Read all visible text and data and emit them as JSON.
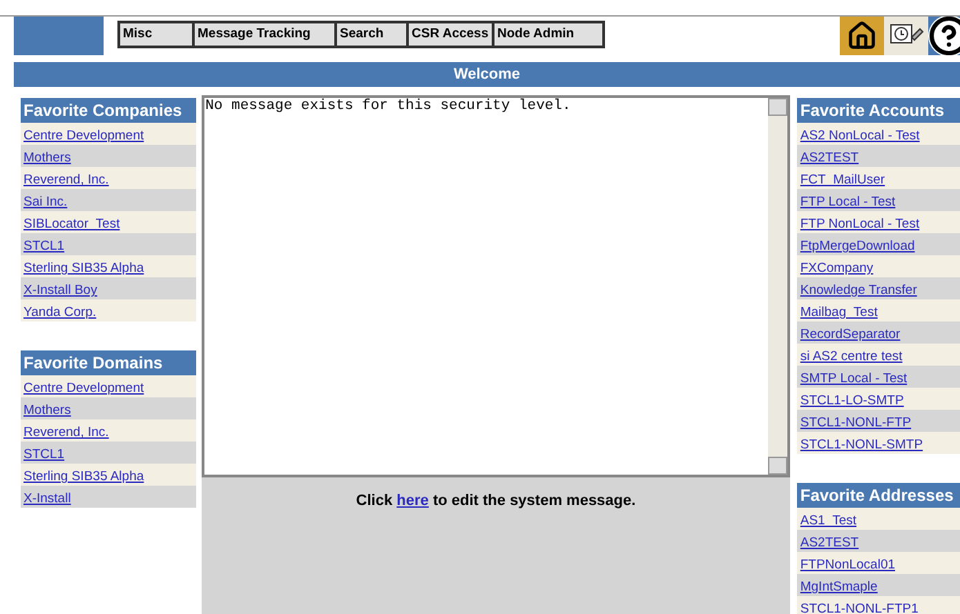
{
  "menu": [
    {
      "label": "Misc"
    },
    {
      "label": "Message Tracking"
    },
    {
      "label": "Search"
    },
    {
      "label": "CSR Access"
    },
    {
      "label": "Node Admin"
    }
  ],
  "banner": {
    "title": "Welcome"
  },
  "left": [
    {
      "title": "Favorite Companies",
      "items": [
        "Centre Development",
        "Mothers",
        "Reverend, Inc.",
        "Sai Inc.",
        "SIBLocator_Test",
        "STCL1",
        "Sterling SIB35 Alpha",
        "X-Install Boy",
        "Yanda Corp."
      ]
    },
    {
      "title": "Favorite Domains",
      "items": [
        "Centre Development",
        "Mothers",
        "Reverend, Inc.",
        "STCL1",
        "Sterling SIB35 Alpha",
        "X-Install"
      ]
    }
  ],
  "message": {
    "text": "No message exists for this security level.",
    "edit_prefix": "Click ",
    "edit_link": "here",
    "edit_suffix": " to edit the system message."
  },
  "right": [
    {
      "title": "Favorite Accounts",
      "items": [
        "AS2 NonLocal - Test",
        "AS2TEST",
        "FCT_MailUser",
        "FTP Local - Test",
        "FTP NonLocal - Test",
        "FtpMergeDownload",
        "FXCompany",
        "Knowledge Transfer",
        "Mailbag_Test",
        "RecordSeparator",
        "si AS2 centre test",
        "SMTP Local - Test",
        "STCL1-LO-SMTP",
        "STCL1-NONL-FTP",
        "STCL1-NONL-SMTP"
      ]
    },
    {
      "title": "Favorite Addresses",
      "items": [
        "AS1_Test",
        "AS2TEST",
        "FTPNonLocal01",
        "MgIntSmaple",
        "STCL1-NONL-FTP1"
      ]
    }
  ]
}
